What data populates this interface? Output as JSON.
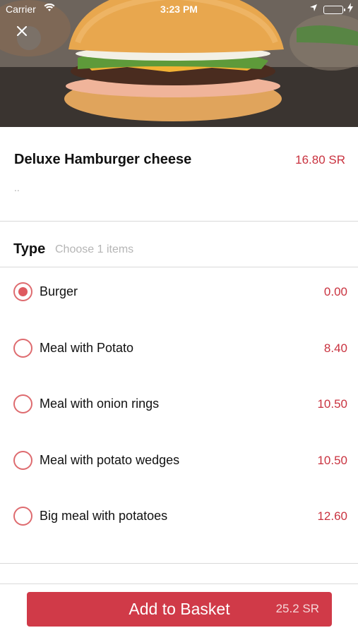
{
  "status_bar": {
    "carrier": "Carrier",
    "time": "3:23 PM"
  },
  "product": {
    "name": "Deluxe Hamburger cheese",
    "price": "16.80 SR",
    "description": ".."
  },
  "type_section": {
    "title": "Type",
    "hint": "Choose 1 items"
  },
  "options": [
    {
      "label": "Burger",
      "price": "0.00",
      "selected": true
    },
    {
      "label": "Meal with Potato",
      "price": "8.40",
      "selected": false
    },
    {
      "label": "Meal with onion rings",
      "price": "10.50",
      "selected": false
    },
    {
      "label": "Meal with potato wedges",
      "price": "10.50",
      "selected": false
    },
    {
      "label": "Big meal with potatoes",
      "price": "12.60",
      "selected": false
    }
  ],
  "basket": {
    "label": "Add to Basket",
    "total": "25.2 SR"
  },
  "colors": {
    "accent": "#d03a48",
    "price_text": "#c9323f",
    "radio": "#de6b6f"
  },
  "icons": [
    "close-icon",
    "wifi-icon",
    "location-arrow-icon",
    "battery-icon",
    "charging-bolt-icon"
  ]
}
